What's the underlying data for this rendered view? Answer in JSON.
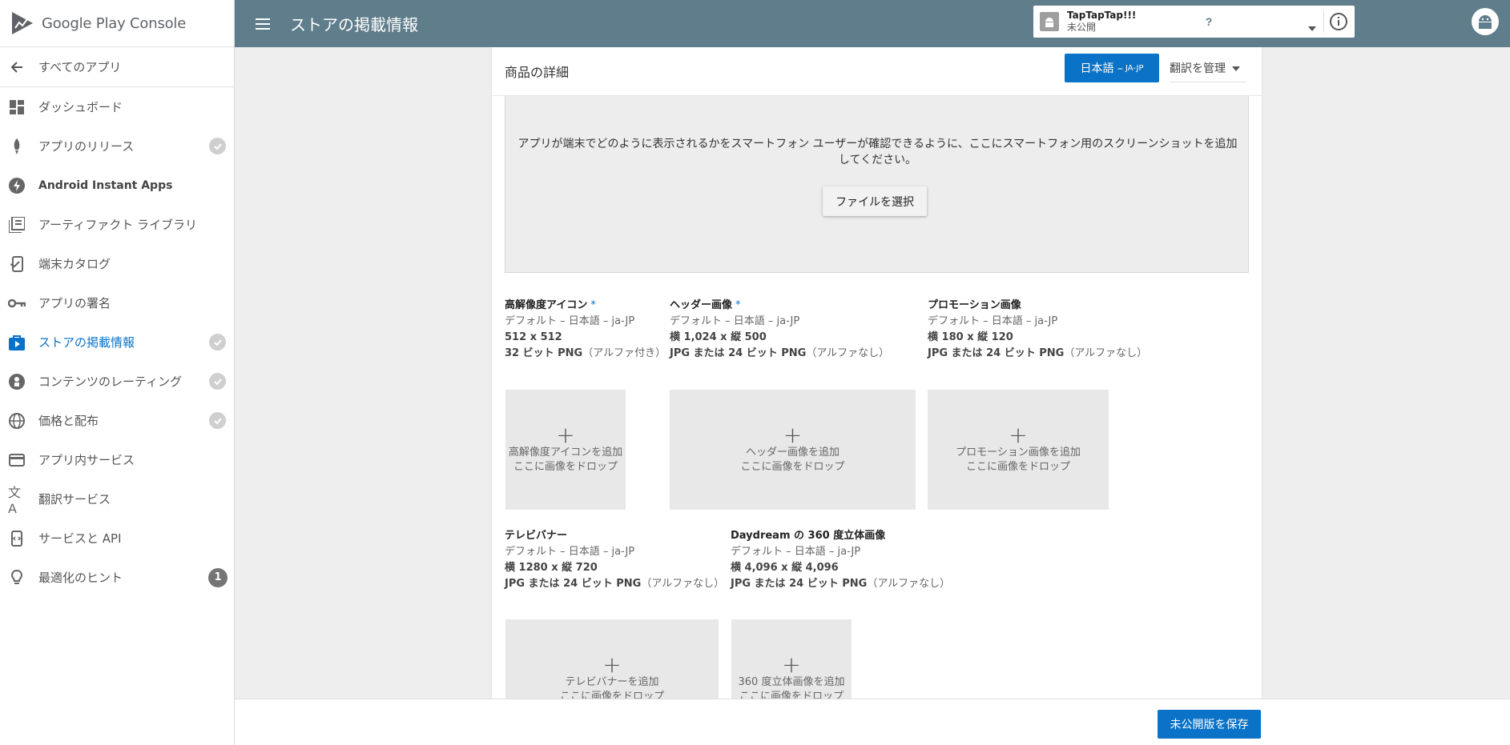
{
  "app": {
    "brand": "Google Play Console",
    "page_title": "ストアの掲載情報"
  },
  "app_picker": {
    "name": "TapTapTap!!!",
    "status": "未公開"
  },
  "sidebar": {
    "back_label": "すべてのアプリ",
    "items": [
      {
        "label": "ダッシュボード",
        "icon": "dashboard-icon"
      },
      {
        "label": "アプリのリリース",
        "icon": "rocket-icon",
        "check": true
      },
      {
        "label": "Android Instant Apps",
        "icon": "flash-icon"
      },
      {
        "label": "アーティファクト ライブラリ",
        "icon": "library-icon"
      },
      {
        "label": "端末カタログ",
        "icon": "device-catalog-icon"
      },
      {
        "label": "アプリの署名",
        "icon": "key-icon"
      },
      {
        "label": "ストアの掲載情報",
        "icon": "store-listing-icon",
        "check": true,
        "active": true
      },
      {
        "label": "コンテンツのレーティング",
        "icon": "rating-icon",
        "check": true
      },
      {
        "label": "価格と配布",
        "icon": "globe-icon",
        "check": true
      },
      {
        "label": "アプリ内サービス",
        "icon": "credit-card-icon"
      },
      {
        "label": "翻訳サービス",
        "icon": "translate-icon"
      },
      {
        "label": "サービスと API",
        "icon": "api-icon"
      },
      {
        "label": "最適化のヒント",
        "icon": "lightbulb-icon",
        "badge": "1"
      }
    ]
  },
  "card": {
    "title": "商品の詳細",
    "lang_button": "日本語 – ",
    "lang_code": "JA-JP",
    "translate_button": "翻訳を管理",
    "screenshot_hint": "アプリが端末でどのように表示されるかをスマートフォン ユーザーが確認できるように、ここにスマートフォン用のスクリーンショットを追加してください。",
    "file_button": "ファイルを選択"
  },
  "specs": {
    "hi_res_icon": {
      "title": "高解像度アイコン",
      "required": "*",
      "lang": "デフォルト – 日本語 – ja-JP",
      "size": "512 x 512",
      "format_bold": "32 ビット PNG",
      "format_rest": "（アルファ付き）"
    },
    "header_image": {
      "title": "ヘッダー画像",
      "required": "*",
      "lang": "デフォルト – 日本語 – ja-JP",
      "size": "横 1,024 x 縦 500",
      "format_bold": "JPG または 24 ビット PNG",
      "format_rest": "（アルファなし）"
    },
    "promo_image": {
      "title": "プロモーション画像",
      "lang": "デフォルト – 日本語 – ja-JP",
      "size": "横 180 x 縦 120",
      "format_bold": "JPG または 24 ビット PNG",
      "format_rest": "（アルファなし）"
    },
    "tv_banner": {
      "title": "テレビバナー",
      "lang": "デフォルト – 日本語 – ja-JP",
      "size": "横 1280 x 縦 720",
      "format_bold": "JPG または 24 ビット PNG",
      "format_rest": "（アルファなし）"
    },
    "daydream": {
      "title": "Daydream の 360 度立体画像",
      "lang": "デフォルト – 日本語 – ja-JP",
      "size": "横 4,096 x 縦 4,096",
      "format_bold": "JPG または 24 ビット PNG",
      "format_rest": "（アルファなし）"
    }
  },
  "slots": {
    "hi_res_icon": {
      "plus": "+",
      "line1": "高解像度アイコンを追加",
      "line2": "ここに画像をドロップ"
    },
    "header_image": {
      "plus": "+",
      "line1": "ヘッダー画像を追加",
      "line2": "ここに画像をドロップ"
    },
    "promo_image": {
      "plus": "+",
      "line1": "プロモーション画像を追加",
      "line2": "ここに画像をドロップ"
    },
    "tv_banner": {
      "plus": "+",
      "line1": "テレビバナーを追加",
      "line2": "ここに画像をドロップ"
    },
    "daydream": {
      "plus": "+",
      "line1": "360 度立体画像を追加",
      "line2": "ここに画像をドロップ"
    }
  },
  "bottom": {
    "save_button": "未公開版を保存"
  },
  "colors": {
    "topbar": "#607d8b",
    "accent": "#0b73c7"
  }
}
